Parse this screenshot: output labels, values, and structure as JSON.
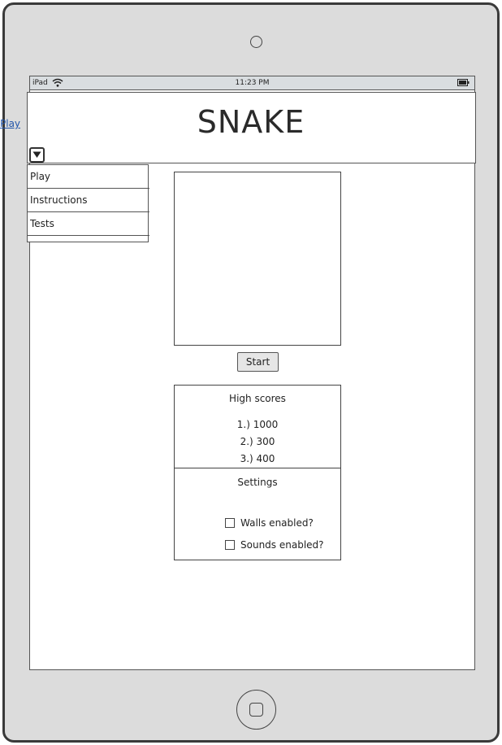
{
  "statusbar": {
    "device_label": "iPad",
    "time": "11:23 PM",
    "wifi_icon": "wifi-icon",
    "battery_icon": "battery-icon"
  },
  "header": {
    "title": "SNAKE",
    "side_link": "Play"
  },
  "menu": {
    "toggle_icon": "triangle-down-icon",
    "items": [
      {
        "label": "Play"
      },
      {
        "label": "Instructions"
      },
      {
        "label": "Tests"
      }
    ]
  },
  "game": {
    "start_label": "Start"
  },
  "high_scores": {
    "title": "High scores",
    "entries": [
      "1.) 1000",
      "2.) 300",
      "3.) 400"
    ]
  },
  "settings": {
    "title": "Settings",
    "options": [
      {
        "label": "Walls enabled?",
        "checked": false
      },
      {
        "label": "Sounds enabled?",
        "checked": false
      }
    ]
  },
  "device": {
    "home_icon": "home-button-icon",
    "camera_icon": "camera-icon"
  }
}
